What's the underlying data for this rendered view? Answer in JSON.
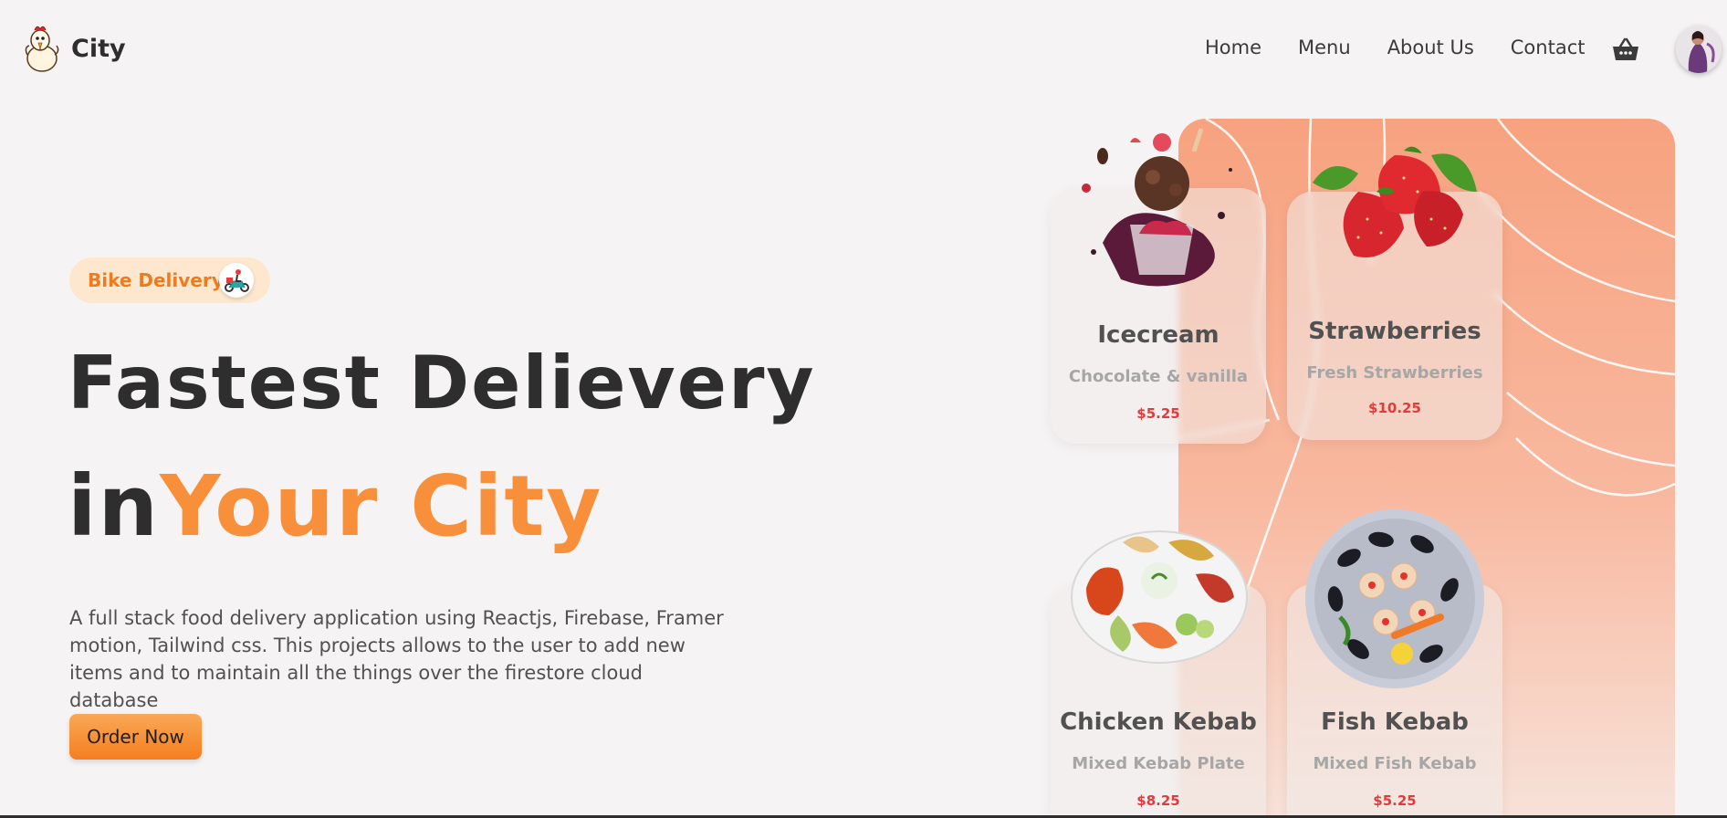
{
  "brand": {
    "name": "City"
  },
  "nav": {
    "items": [
      {
        "label": "Home"
      },
      {
        "label": "Menu"
      },
      {
        "label": "About Us"
      },
      {
        "label": "Contact"
      }
    ],
    "cart_icon": "basket-icon",
    "avatar_icon": "user-avatar"
  },
  "hero": {
    "badge": {
      "label": "Bike Delivery",
      "icon": "scooter-icon"
    },
    "headline_line1": "Fastest Delievery",
    "headline_in": "in",
    "headline_city": "Your City",
    "description": "A full stack food delivery application using Reactjs, Firebase, Framer motion, Tailwind css. This projects allows to the user to add new items and to maintain all the things over the firestore cloud database",
    "cta_label": "Order Now"
  },
  "menu_cards": [
    {
      "title": "Icecream",
      "subtitle": "Chocolate & vanilla",
      "price": "5.25",
      "image": "icecream-image"
    },
    {
      "title": "Strawberries",
      "subtitle": "Fresh Strawberries",
      "price": "10.25",
      "image": "strawberries-image"
    },
    {
      "title": "Chicken Kebab",
      "subtitle": "Mixed Kebab Plate",
      "price": "8.25",
      "image": "chicken-kebab-image"
    },
    {
      "title": "Fish Kebab",
      "subtitle": "Mixed Fish Kebab",
      "price": "5.25",
      "image": "fish-kebab-image"
    }
  ],
  "currency_symbol": "$",
  "colors": {
    "accent": "#f88f3b",
    "badge_bg": "#fde8cf",
    "badge_text": "#f07b1d",
    "price": "#e23b3b",
    "panel": "#f7a27f"
  }
}
